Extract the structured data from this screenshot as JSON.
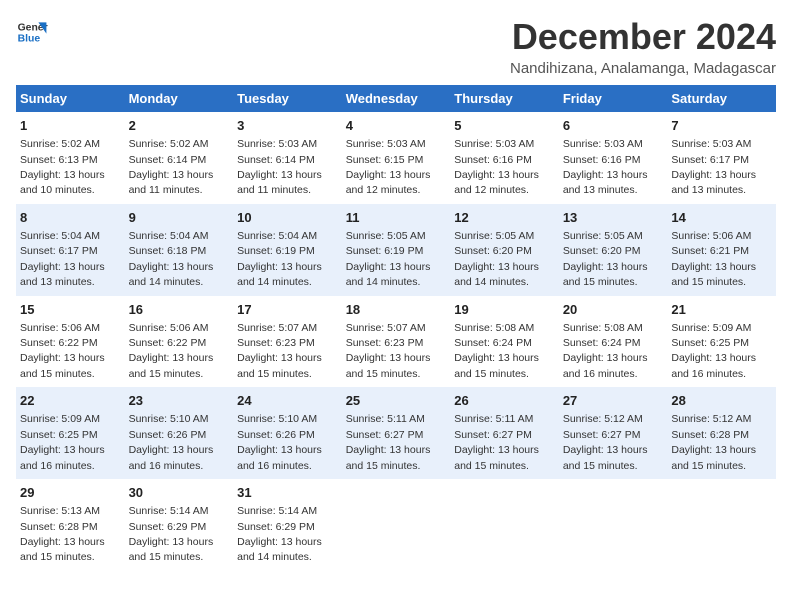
{
  "logo": {
    "line1": "General",
    "line2": "Blue"
  },
  "title": "December 2024",
  "location": "Nandihizana, Analamanga, Madagascar",
  "days_of_week": [
    "Sunday",
    "Monday",
    "Tuesday",
    "Wednesday",
    "Thursday",
    "Friday",
    "Saturday"
  ],
  "weeks": [
    [
      {
        "day": "1",
        "sunrise": "5:02 AM",
        "sunset": "6:13 PM",
        "daylight": "13 hours and 10 minutes."
      },
      {
        "day": "2",
        "sunrise": "5:02 AM",
        "sunset": "6:14 PM",
        "daylight": "13 hours and 11 minutes."
      },
      {
        "day": "3",
        "sunrise": "5:03 AM",
        "sunset": "6:14 PM",
        "daylight": "13 hours and 11 minutes."
      },
      {
        "day": "4",
        "sunrise": "5:03 AM",
        "sunset": "6:15 PM",
        "daylight": "13 hours and 12 minutes."
      },
      {
        "day": "5",
        "sunrise": "5:03 AM",
        "sunset": "6:16 PM",
        "daylight": "13 hours and 12 minutes."
      },
      {
        "day": "6",
        "sunrise": "5:03 AM",
        "sunset": "6:16 PM",
        "daylight": "13 hours and 13 minutes."
      },
      {
        "day": "7",
        "sunrise": "5:03 AM",
        "sunset": "6:17 PM",
        "daylight": "13 hours and 13 minutes."
      }
    ],
    [
      {
        "day": "8",
        "sunrise": "5:04 AM",
        "sunset": "6:17 PM",
        "daylight": "13 hours and 13 minutes."
      },
      {
        "day": "9",
        "sunrise": "5:04 AM",
        "sunset": "6:18 PM",
        "daylight": "13 hours and 14 minutes."
      },
      {
        "day": "10",
        "sunrise": "5:04 AM",
        "sunset": "6:19 PM",
        "daylight": "13 hours and 14 minutes."
      },
      {
        "day": "11",
        "sunrise": "5:05 AM",
        "sunset": "6:19 PM",
        "daylight": "13 hours and 14 minutes."
      },
      {
        "day": "12",
        "sunrise": "5:05 AM",
        "sunset": "6:20 PM",
        "daylight": "13 hours and 14 minutes."
      },
      {
        "day": "13",
        "sunrise": "5:05 AM",
        "sunset": "6:20 PM",
        "daylight": "13 hours and 15 minutes."
      },
      {
        "day": "14",
        "sunrise": "5:06 AM",
        "sunset": "6:21 PM",
        "daylight": "13 hours and 15 minutes."
      }
    ],
    [
      {
        "day": "15",
        "sunrise": "5:06 AM",
        "sunset": "6:22 PM",
        "daylight": "13 hours and 15 minutes."
      },
      {
        "day": "16",
        "sunrise": "5:06 AM",
        "sunset": "6:22 PM",
        "daylight": "13 hours and 15 minutes."
      },
      {
        "day": "17",
        "sunrise": "5:07 AM",
        "sunset": "6:23 PM",
        "daylight": "13 hours and 15 minutes."
      },
      {
        "day": "18",
        "sunrise": "5:07 AM",
        "sunset": "6:23 PM",
        "daylight": "13 hours and 15 minutes."
      },
      {
        "day": "19",
        "sunrise": "5:08 AM",
        "sunset": "6:24 PM",
        "daylight": "13 hours and 15 minutes."
      },
      {
        "day": "20",
        "sunrise": "5:08 AM",
        "sunset": "6:24 PM",
        "daylight": "13 hours and 16 minutes."
      },
      {
        "day": "21",
        "sunrise": "5:09 AM",
        "sunset": "6:25 PM",
        "daylight": "13 hours and 16 minutes."
      }
    ],
    [
      {
        "day": "22",
        "sunrise": "5:09 AM",
        "sunset": "6:25 PM",
        "daylight": "13 hours and 16 minutes."
      },
      {
        "day": "23",
        "sunrise": "5:10 AM",
        "sunset": "6:26 PM",
        "daylight": "13 hours and 16 minutes."
      },
      {
        "day": "24",
        "sunrise": "5:10 AM",
        "sunset": "6:26 PM",
        "daylight": "13 hours and 16 minutes."
      },
      {
        "day": "25",
        "sunrise": "5:11 AM",
        "sunset": "6:27 PM",
        "daylight": "13 hours and 15 minutes."
      },
      {
        "day": "26",
        "sunrise": "5:11 AM",
        "sunset": "6:27 PM",
        "daylight": "13 hours and 15 minutes."
      },
      {
        "day": "27",
        "sunrise": "5:12 AM",
        "sunset": "6:27 PM",
        "daylight": "13 hours and 15 minutes."
      },
      {
        "day": "28",
        "sunrise": "5:12 AM",
        "sunset": "6:28 PM",
        "daylight": "13 hours and 15 minutes."
      }
    ],
    [
      {
        "day": "29",
        "sunrise": "5:13 AM",
        "sunset": "6:28 PM",
        "daylight": "13 hours and 15 minutes."
      },
      {
        "day": "30",
        "sunrise": "5:14 AM",
        "sunset": "6:29 PM",
        "daylight": "13 hours and 15 minutes."
      },
      {
        "day": "31",
        "sunrise": "5:14 AM",
        "sunset": "6:29 PM",
        "daylight": "13 hours and 14 minutes."
      },
      null,
      null,
      null,
      null
    ]
  ]
}
